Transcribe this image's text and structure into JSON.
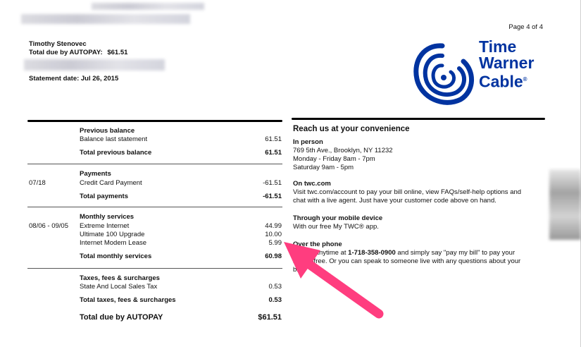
{
  "header": {
    "name": "Timothy Stenovec",
    "total_due_label": "Total due by AUTOPAY:",
    "total_due_value": "$61.51",
    "statement_date": "Statement date: Jul 26, 2015",
    "page": "Page 4 of 4"
  },
  "logo": {
    "line1": "Time",
    "line2": "Warner",
    "line3": "Cable",
    "color": "#0033a0"
  },
  "previous_balance": {
    "title": "Previous balance",
    "items": [
      {
        "label": "Balance last statement",
        "amount": "61.51"
      }
    ],
    "total_label": "Total previous balance",
    "total_amount": "61.51"
  },
  "payments": {
    "title": "Payments",
    "date": "07/18",
    "items": [
      {
        "label": "Credit Card Payment",
        "amount": "-61.51"
      }
    ],
    "total_label": "Total payments",
    "total_amount": "-61.51"
  },
  "monthly": {
    "title": "Monthly services",
    "date_range": "08/06 - 09/05",
    "items": [
      {
        "label": "Extreme Internet",
        "amount": "44.99"
      },
      {
        "label": "Ultimate 100 Upgrade",
        "amount": "10.00"
      },
      {
        "label": "Internet Modem Lease",
        "amount": "5.99"
      }
    ],
    "total_label": "Total monthly services",
    "total_amount": "60.98"
  },
  "taxes": {
    "title": "Taxes, fees & surcharges",
    "items": [
      {
        "label": "State And Local Sales Tax",
        "amount": "0.53"
      }
    ],
    "total_label": "Total taxes, fees & surcharges",
    "total_amount": "0.53"
  },
  "grand_total": {
    "label": "Total due by AUTOPAY",
    "amount": "$61.51"
  },
  "contact": {
    "title": "Reach us at your convenience",
    "in_person_title": "In person",
    "in_person_lines": [
      "769 5th Ave., Brooklyn, NY 11232",
      "Monday - Friday 8am - 7pm",
      "Saturday 9am - 5pm"
    ],
    "online_title": "On twc.com",
    "online_lines": [
      "Visit twc.com/account to pay your bill online, view FAQs/self-help options and",
      "chat with a live agent. Just have your customer code above on hand."
    ],
    "mobile_title": "Through your mobile device",
    "mobile_line": "With our free My TWC® app.",
    "phone_title": "Over the phone",
    "phone_line1_a": "Call us anytime at",
    "phone_number": "1-718-358-0900",
    "phone_line1_b": "and simply say \"pay my bill\" to pay your",
    "phone_line2": "bill toll-free. Or you can speak to someone live with any questions about your",
    "phone_line3": "bill."
  },
  "annotation": {
    "arrow_color": "#ff3d7f"
  }
}
